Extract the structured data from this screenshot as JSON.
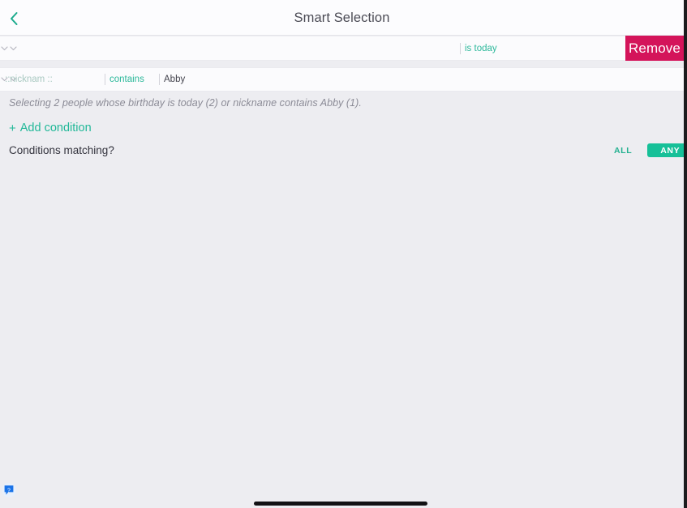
{
  "header": {
    "title": "Smart Selection",
    "back_icon": "chevron-left-icon"
  },
  "conditions": [
    {
      "field_label": "",
      "field_chevron_icon": "chevron-down-icon",
      "operator_label": "is today",
      "operator_chevron_icon": "chevron-down-icon",
      "value_label": ""
    },
    {
      "field_label": "::nicknam ::",
      "field_chevron_icon": "chevron-down-icon",
      "operator_label": "contains",
      "operator_chevron_icon": "chevron-down-icon",
      "value_label": "Abby"
    }
  ],
  "remove_button": {
    "label": "Remove",
    "color": "#d4145a"
  },
  "summary": {
    "text": "Selecting 2 people whose birthday is today (2) or nickname contains Abby (1)."
  },
  "add_condition": {
    "plus": "+",
    "label": "Add condition"
  },
  "matching": {
    "question_label": "Conditions matching?",
    "options": [
      {
        "label": "ALL",
        "selected": false
      },
      {
        "label": "ANY",
        "selected": true
      }
    ]
  },
  "help": {
    "icon": "question-mark-help-icon"
  },
  "colors": {
    "accent_green": "#21b898",
    "accent_selected": "#16c098",
    "destructive": "#d4145a",
    "row_bg": "#fbfbfd",
    "page_bg": "#ededf1",
    "help_blue": "#1a73e8"
  }
}
